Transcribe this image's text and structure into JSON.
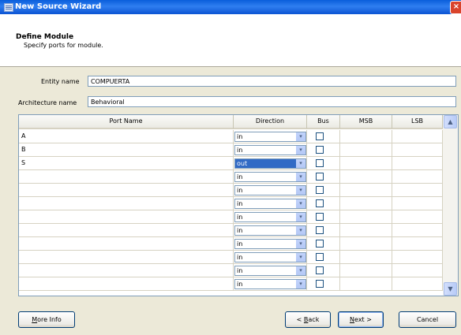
{
  "window": {
    "title": "New Source Wizard",
    "close_glyph": "×"
  },
  "header": {
    "title": "Define Module",
    "subtitle": "Specify ports for module."
  },
  "form": {
    "entity_label": "Entity name",
    "entity_value": "COMPUERTA",
    "arch_label": "Architecture name",
    "arch_value": "Behavioral"
  },
  "table": {
    "columns": [
      "Port Name",
      "Direction",
      "Bus",
      "MSB",
      "LSB"
    ],
    "rows": [
      {
        "port": "A",
        "direction": "in",
        "bus": false,
        "msb": "",
        "lsb": ""
      },
      {
        "port": "B",
        "direction": "in",
        "bus": false,
        "msb": "",
        "lsb": ""
      },
      {
        "port": "S",
        "direction": "out",
        "bus": false,
        "msb": "",
        "lsb": "",
        "selected": true
      },
      {
        "port": "",
        "direction": "in",
        "bus": false,
        "msb": "",
        "lsb": ""
      },
      {
        "port": "",
        "direction": "in",
        "bus": false,
        "msb": "",
        "lsb": ""
      },
      {
        "port": "",
        "direction": "in",
        "bus": false,
        "msb": "",
        "lsb": ""
      },
      {
        "port": "",
        "direction": "in",
        "bus": false,
        "msb": "",
        "lsb": ""
      },
      {
        "port": "",
        "direction": "in",
        "bus": false,
        "msb": "",
        "lsb": ""
      },
      {
        "port": "",
        "direction": "in",
        "bus": false,
        "msb": "",
        "lsb": ""
      },
      {
        "port": "",
        "direction": "in",
        "bus": false,
        "msb": "",
        "lsb": ""
      },
      {
        "port": "",
        "direction": "in",
        "bus": false,
        "msb": "",
        "lsb": ""
      },
      {
        "port": "",
        "direction": "in",
        "bus": false,
        "msb": "",
        "lsb": ""
      }
    ],
    "dropdown_arrow": "▾",
    "scroll_up": "▲",
    "scroll_down": "▼"
  },
  "buttons": {
    "more_info_u": "M",
    "more_info_rest": "ore Info",
    "back_pre": "< ",
    "back_u": "B",
    "back_rest": "ack",
    "next_u": "N",
    "next_rest": "ext >",
    "cancel": "Cancel"
  },
  "colors": {
    "title_bar": "#0a5edb",
    "selection": "#316ac5",
    "dialog_bg": "#ece9d8"
  }
}
